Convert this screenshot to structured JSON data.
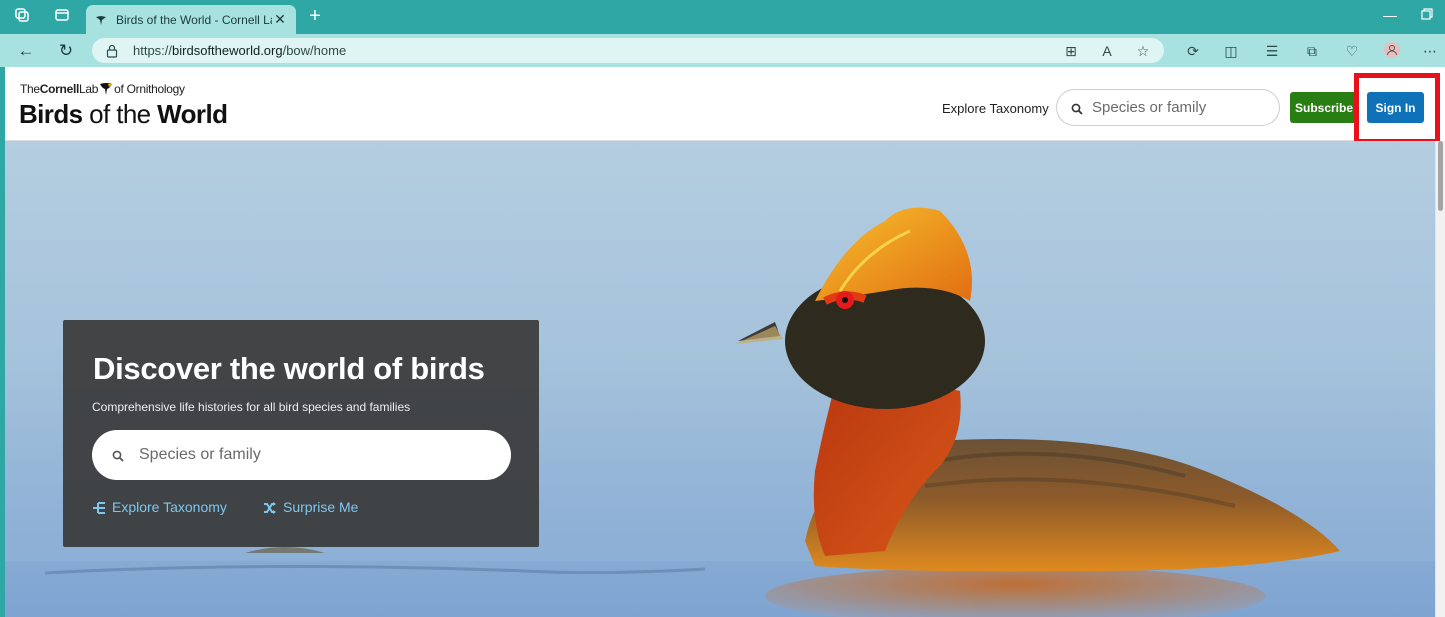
{
  "browser": {
    "tab_title": "Birds of the World - Cornell Lab o",
    "url_prefix": "https://",
    "url_domain": "birdsoftheworld.org",
    "url_path": "/bow/home"
  },
  "header": {
    "logo_the": "The",
    "logo_cornell": "Cornell",
    "logo_lab": "Lab",
    "logo_of": "of Ornithology",
    "logo_birds": "Birds",
    "logo_ofthe": " of the ",
    "logo_world": "World",
    "nav_explore": "Explore Taxonomy",
    "search_placeholder": "Species or family",
    "subscribe_label": "Subscribe",
    "signin_label": "Sign In"
  },
  "hero": {
    "title": "Discover the world of birds",
    "subtitle": "Comprehensive life histories for all bird species and families",
    "search_placeholder": "Species or family",
    "explore_link": "Explore Taxonomy",
    "surprise_link": "Surprise Me"
  },
  "colors": {
    "chrome_teal": "#2fa7a5",
    "subscribe_green": "#297e13",
    "signin_blue": "#0f72b8",
    "highlight_red": "#e8111b",
    "link_blue": "#7fc6ee"
  }
}
